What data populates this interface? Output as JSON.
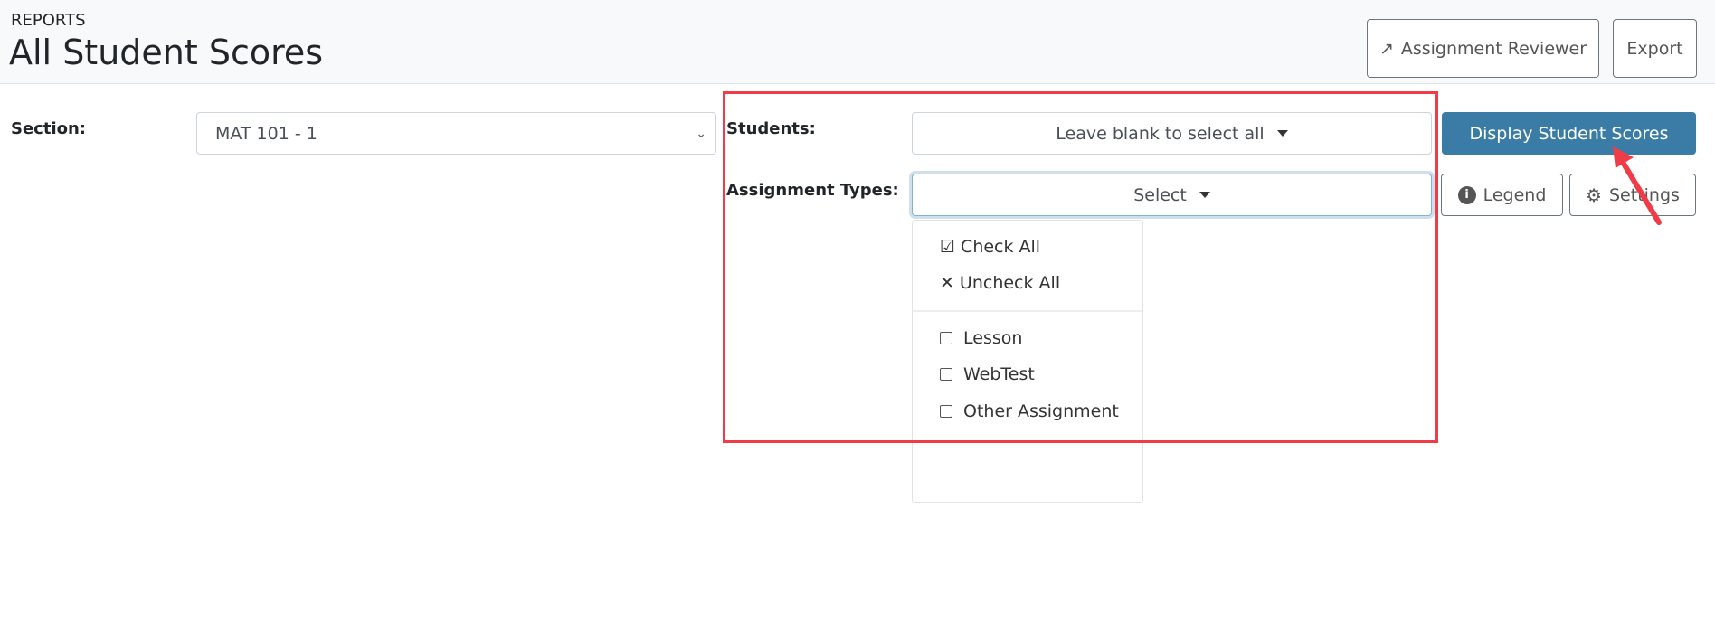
{
  "header": {
    "breadcrumb": "REPORTS",
    "title": "All Student Scores",
    "assignment_reviewer": "Assignment Reviewer",
    "export": "Export"
  },
  "form": {
    "section_label": "Section:",
    "section_value": "MAT 101 - 1",
    "students_label": "Students:",
    "students_placeholder": "Leave blank to select all",
    "types_label": "Assignment Types:",
    "types_value": "Select",
    "display_button": "Display Student Scores",
    "legend_button": "Legend",
    "settings_button": "Settings"
  },
  "menu": {
    "check_all": "Check All",
    "uncheck_all": "Uncheck All",
    "options": [
      {
        "label": "Lesson",
        "checked": false
      },
      {
        "label": "WebTest",
        "checked": false
      },
      {
        "label": "Other Assignment",
        "checked": false
      }
    ]
  },
  "colors": {
    "primary": "#3a7ca5",
    "annotation": "#f03c46"
  }
}
